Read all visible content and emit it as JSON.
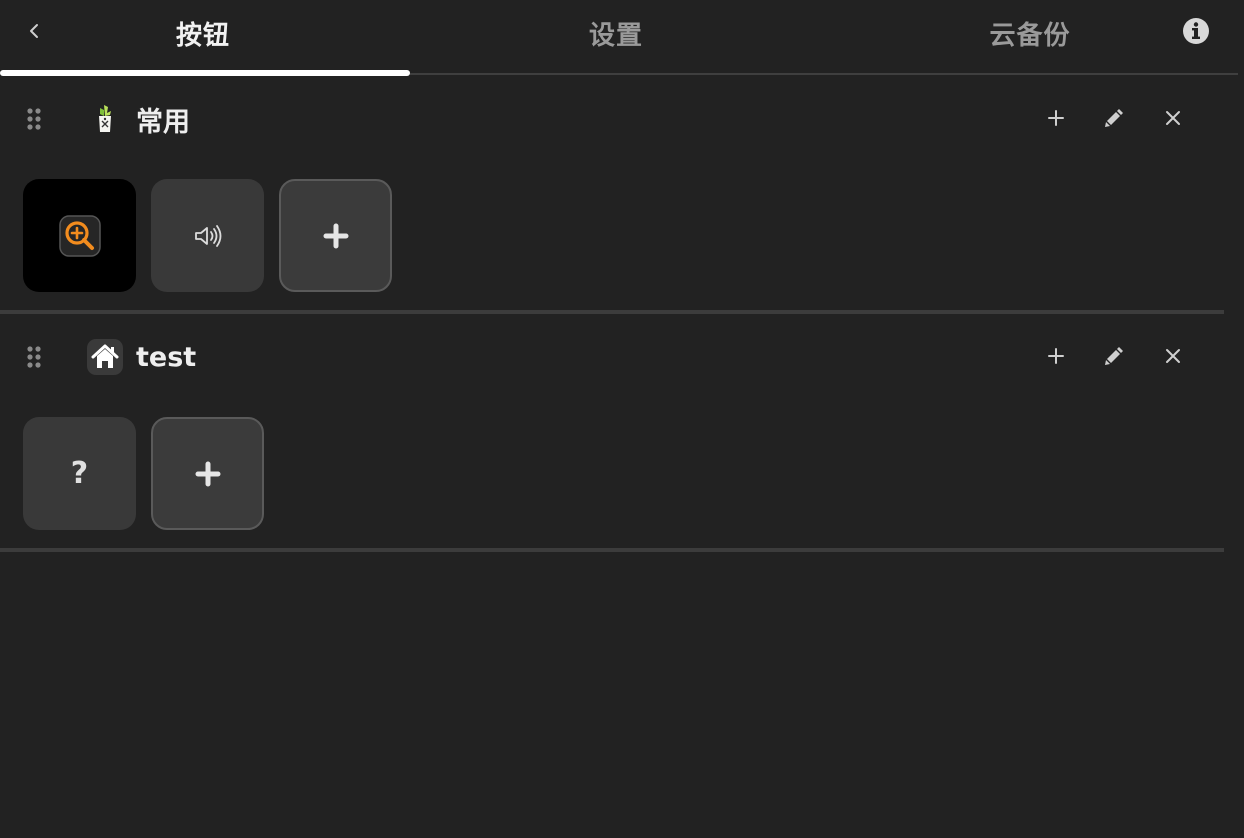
{
  "tabs": [
    {
      "label": "按钮",
      "active": true
    },
    {
      "label": "设置",
      "active": false
    },
    {
      "label": "云备份",
      "active": false
    }
  ],
  "icons": {
    "back": "chevron-left-icon",
    "info": "info-icon",
    "drag": "drag-handle-icon",
    "add": "plus-icon",
    "edit": "pencil-icon",
    "close": "close-icon",
    "zoom": "zoom-in-icon",
    "volume": "volume-icon",
    "home": "home-icon",
    "unknown": "question-icon"
  },
  "groups": [
    {
      "title": "常用",
      "tiles": [
        {
          "type": "icon",
          "icon": "zoom-in-icon"
        },
        {
          "type": "icon",
          "icon": "volume-icon"
        },
        {
          "type": "add"
        }
      ]
    },
    {
      "title": "test",
      "tiles": [
        {
          "type": "unknown",
          "label": "?"
        },
        {
          "type": "add"
        }
      ]
    }
  ],
  "colors": {
    "background": "#222222",
    "accent": "#f28c1e",
    "tab_active": "#f2f2f2",
    "tab_inactive": "#9a9a9a"
  }
}
